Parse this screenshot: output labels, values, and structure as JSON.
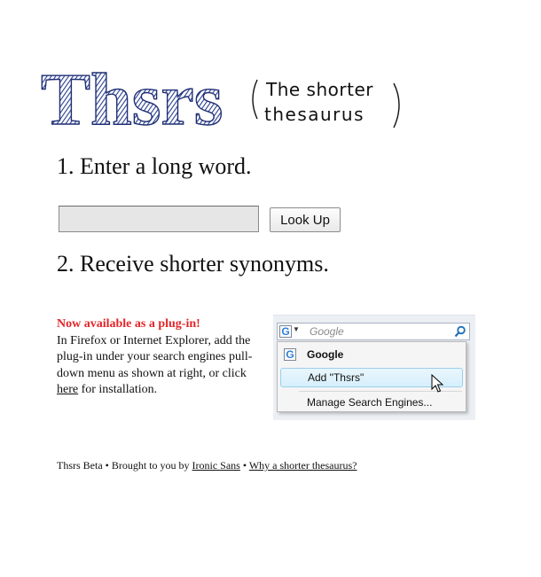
{
  "branding": {
    "logo_text": "Thsrs",
    "tagline_line1": "The shorter",
    "tagline_line2": "thesaurus"
  },
  "steps": {
    "step1": "1. Enter a long word.",
    "step2": "2. Receive shorter synonyms."
  },
  "search": {
    "value": "",
    "button_label": "Look Up"
  },
  "plugin": {
    "title": "Now available as a plug-in!",
    "body_before_link": "In Firefox or Internet Explorer, add the plug-in under your search engines pull-down menu as shown at right, or click ",
    "link_text": "here",
    "body_after_link": " for installation."
  },
  "screenshot": {
    "engine_icon": "G",
    "search_placeholder": "Google",
    "menu_items": [
      "Google",
      "Add \"Thsrs\"",
      "Manage Search Engines..."
    ]
  },
  "footer": {
    "prefix": "Thsrs Beta • Brought to you by ",
    "link1": "Ironic Sans",
    "separator": " • ",
    "link2": "Why a shorter thesaurus?"
  },
  "colors": {
    "accent_red": "#e3262a",
    "logo_blue": "#2a3f8f"
  }
}
